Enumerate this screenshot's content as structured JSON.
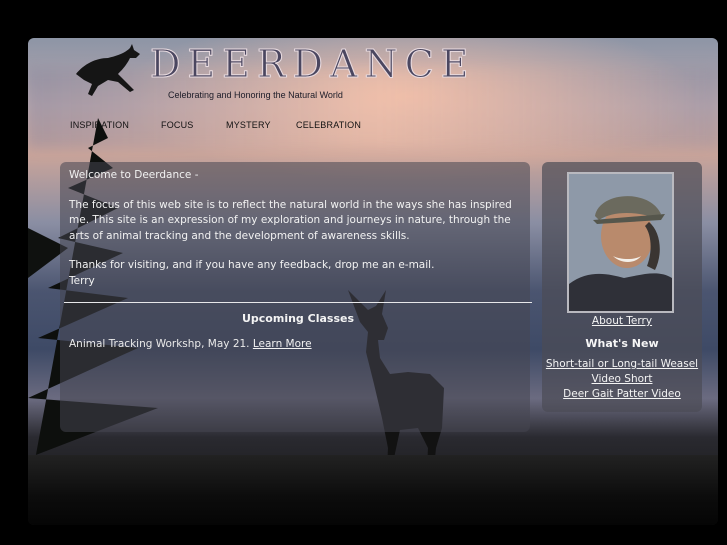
{
  "header": {
    "site_title": "DEERDANCE",
    "tagline": "Celebrating and Honoring the Natural World"
  },
  "nav": {
    "items": [
      {
        "label": "INSPIRATION"
      },
      {
        "label": "FOCUS"
      },
      {
        "label": "MYSTERY"
      },
      {
        "label": "CELEBRATION"
      }
    ]
  },
  "main": {
    "welcome": "Welcome to Deerdance -",
    "intro": "The focus of this web site is to reflect the natural world in the ways she has inspired me. This site is an expression of my exploration and journeys in nature, through the arts of animal tracking and the development of awareness skills.",
    "thanks": "Thanks for visiting, and if you have any feedback, drop me an e-mail.",
    "signature": "Terry",
    "classes_heading": "Upcoming Classes",
    "class_item": "Animal Tracking Workshp, May 21.",
    "class_link": "Learn More"
  },
  "sidebar": {
    "about_link": "About Terry",
    "whats_new_heading": "What's New",
    "links": [
      {
        "label": "Short-tail or Long-tail Weasel"
      },
      {
        "label": "Video Short"
      },
      {
        "label": "Deer Gait Patter Video"
      }
    ]
  }
}
